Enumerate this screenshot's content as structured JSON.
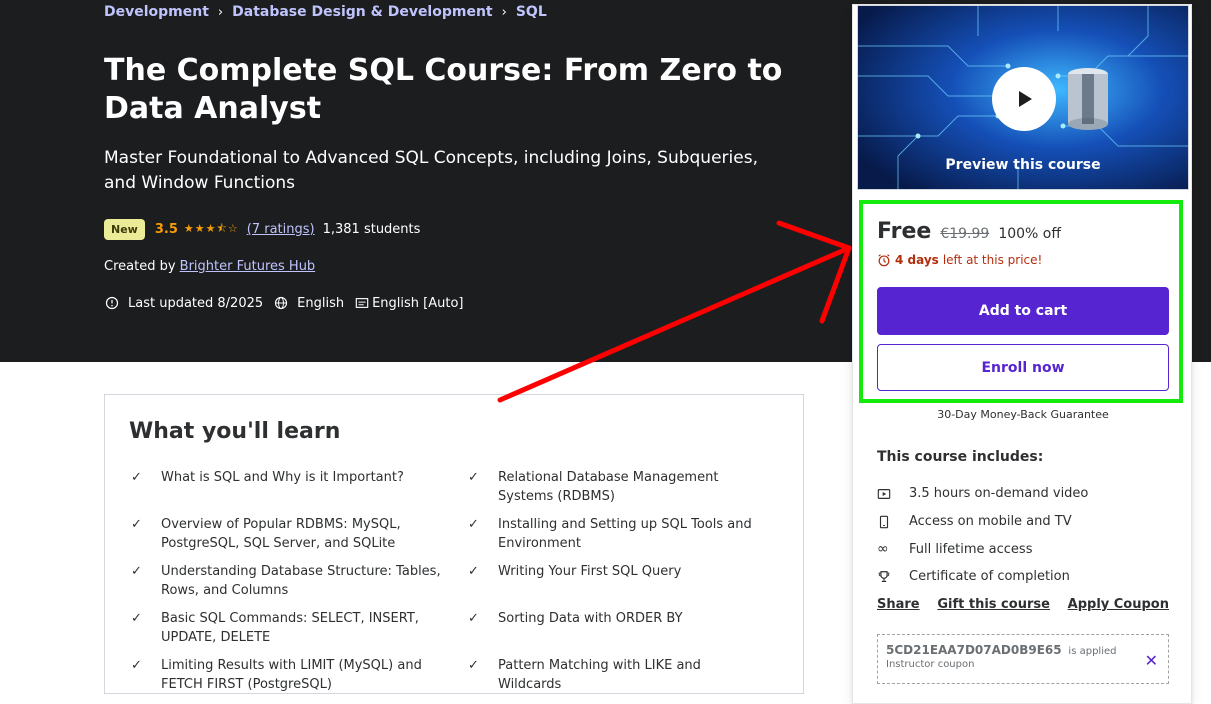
{
  "breadcrumb": [
    "Development",
    "Database Design & Development",
    "SQL"
  ],
  "course": {
    "title": "The Complete SQL Course: From Zero to Data Analyst",
    "subtitle": "Master Foundational to Advanced SQL Concepts, including Joins, Subqueries, and Window Functions",
    "badge": "New",
    "rating": "3.5",
    "stars_filled": 3.5,
    "ratings_link": "(7 ratings)",
    "students": "1,381 students",
    "created_by_label": "Created by",
    "author": "Brighter Futures Hub",
    "last_updated": "Last updated 8/2025",
    "language": "English",
    "captions": "English [Auto]"
  },
  "learn": {
    "heading": "What you'll learn",
    "items": [
      "What is SQL and Why is it Important?",
      "Relational Database Management Systems (RDBMS)",
      "Overview of Popular RDBMS: MySQL, PostgreSQL, SQL Server, and SQLite",
      "Installing and Setting up SQL Tools and Environment",
      "Understanding Database Structure: Tables, Rows, and Columns",
      "Writing Your First SQL Query",
      "Basic SQL Commands: SELECT, INSERT, UPDATE, DELETE",
      "Sorting Data with ORDER BY",
      "Limiting Results with LIMIT (MySQL) and FETCH FIRST (PostgreSQL)",
      "Pattern Matching with LIKE and Wildcards"
    ]
  },
  "card": {
    "preview_label": "Preview this course",
    "price": "Free",
    "original_price": "€19.99",
    "discount": "100% off",
    "timer_bold": "4 days",
    "timer_rest": "left at this price!",
    "add_to_cart": "Add to cart",
    "enroll_now": "Enroll now",
    "guarantee": "30-Day Money-Back Guarantee",
    "includes_title": "This course includes:",
    "includes": [
      {
        "icon": "video-icon",
        "text": "3.5 hours on-demand video"
      },
      {
        "icon": "mobile-icon",
        "text": "Access on mobile and TV"
      },
      {
        "icon": "infinity-icon",
        "text": "Full lifetime access"
      },
      {
        "icon": "trophy-icon",
        "text": "Certificate of completion"
      }
    ],
    "links": {
      "share": "Share",
      "gift": "Gift this course",
      "coupon": "Apply Coupon"
    },
    "coupon": {
      "code": "5CD21EAA7D07AD0B9E65",
      "applied": "is applied",
      "label": "Instructor coupon"
    }
  },
  "colors": {
    "hero_bg": "#1c1d1f",
    "accent_purple": "#5624d0",
    "link_lavender": "#c0c4fc",
    "star_orange": "#f69c08",
    "timer_red": "#b32d0f",
    "highlight_green": "#15ea0d",
    "arrow_red": "#ff0000"
  }
}
